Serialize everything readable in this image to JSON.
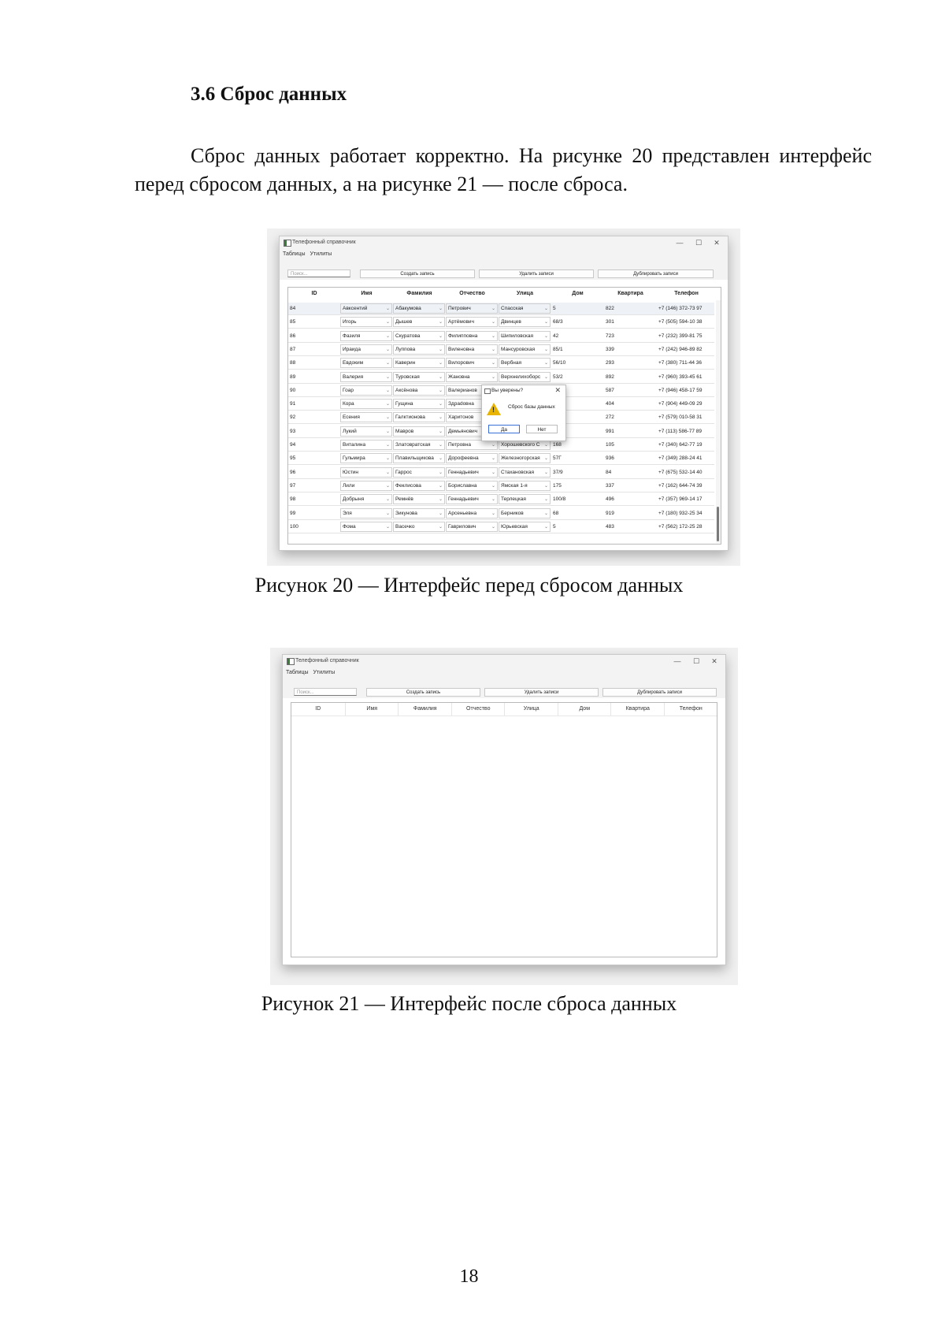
{
  "section_heading": "3.6 Сброс данных",
  "paragraph": "Сброс данных работает корректно. На рисунке 20 представлен интерфейс перед сбросом данных, а на рисунке 21 — после сброса.",
  "figure20": {
    "caption": "Рисунок 20 — Интерфейс перед сбросом данных",
    "window_title": "Телефонный справочник",
    "window_controls": [
      "—",
      "☐",
      "✕"
    ],
    "menu": [
      "Таблицы",
      "Утилиты"
    ],
    "search_placeholder": "Поиск...",
    "buttons": [
      "Создать запись",
      "Удалить записи",
      "Дублировать записи"
    ],
    "columns": [
      "ID",
      "Имя",
      "Фамилия",
      "Отчество",
      "Улица",
      "Дом",
      "Квартира",
      "Телефон"
    ],
    "rows": [
      [
        "84",
        "Авксентий",
        "Абакумова",
        "Петрович",
        "Спасская",
        "5",
        "822",
        "+7 (146) 372-73 97"
      ],
      [
        "85",
        "Игорь",
        "Дышев",
        "Артёмович",
        "Двинцев",
        "68/3",
        "301",
        "+7 (505) 594-10 38"
      ],
      [
        "86",
        "Фазиля",
        "Скуратова",
        "Филипповна",
        "Шипиловская",
        "42",
        "723",
        "+7 (232) 399-81 75"
      ],
      [
        "87",
        "Ираида",
        "Луппова",
        "Виленовна",
        "Мансуровская",
        "85/1",
        "339",
        "+7 (242) 946-89 82"
      ],
      [
        "88",
        "Евдоким",
        "Каверин",
        "Вилорович",
        "Вербная",
        "56/10",
        "293",
        "+7 (380) 711-44 36"
      ],
      [
        "89",
        "Валерия",
        "Туровская",
        "Жановна",
        "Верхнелихоборс",
        "53/2",
        "892",
        "+7 (960) 393-45 61"
      ],
      [
        "90",
        "Гоар",
        "Аксёнова",
        "Валерианов",
        "",
        "",
        "587",
        "+7 (946) 458-17 59"
      ],
      [
        "91",
        "Кора",
        "Гущина",
        "Здраdовна",
        "",
        "3",
        "404",
        "+7 (904) 449-09 29"
      ],
      [
        "92",
        "Есения",
        "Галктионова",
        "Харитонов",
        "",
        "",
        "272",
        "+7 (579) 010-58 31"
      ],
      [
        "93",
        "Лукий",
        "Мавров",
        "Демьянович",
        "",
        "",
        "991",
        "+7 (113) 586-77 89"
      ],
      [
        "94",
        "Виталина",
        "Златовратская",
        "Петровна",
        "Хорошевского С",
        "168",
        "105",
        "+7 (340) 642-77 19"
      ],
      [
        "95",
        "Гульмира",
        "Плавильщикова",
        "Дорофеевна",
        "Железногорская",
        "57Г",
        "936",
        "+7 (349) 288-24 41"
      ],
      [
        "96",
        "Юстин",
        "Гаррос",
        "Геннадьевич",
        "Стахановская",
        "37/9",
        "84",
        "+7 (675) 532-14 40"
      ],
      [
        "97",
        "Лили",
        "Феклисова",
        "Бориславна",
        "Ямская 1-я",
        "175",
        "337",
        "+7 (162) 644-74 39"
      ],
      [
        "98",
        "Добрыня",
        "Ремнёв",
        "Геннадьевич",
        "Терлецкая",
        "100/8",
        "496",
        "+7 (357) 969-14 17"
      ],
      [
        "99",
        "Эля",
        "Зикунова",
        "Арсеньевна",
        "Берников",
        "68",
        "919",
        "+7 (180) 932-25 34"
      ],
      [
        "100",
        "Фома",
        "Васечко",
        "Гаврилович",
        "Юрьевская",
        "5",
        "483",
        "+7 (562) 172-25 28"
      ]
    ],
    "dialog": {
      "title": "Вы уверены?",
      "message": "Сброс базы данных",
      "yes": "Да",
      "no": "Нет"
    }
  },
  "figure21": {
    "caption": "Рисунок 21 — Интерфейс после сброса данных",
    "window_title": "Телефонный справочник",
    "window_controls": [
      "—",
      "☐",
      "✕"
    ],
    "menu": [
      "Таблицы",
      "Утилиты"
    ],
    "search_placeholder": "Поиск...",
    "buttons": [
      "Создать запись",
      "Удалить записи",
      "Дублировать записи"
    ],
    "columns": [
      "ID",
      "Имя",
      "Фамилия",
      "Отчество",
      "Улица",
      "Дом",
      "Квартира",
      "Телефон"
    ]
  },
  "page_number": "18"
}
